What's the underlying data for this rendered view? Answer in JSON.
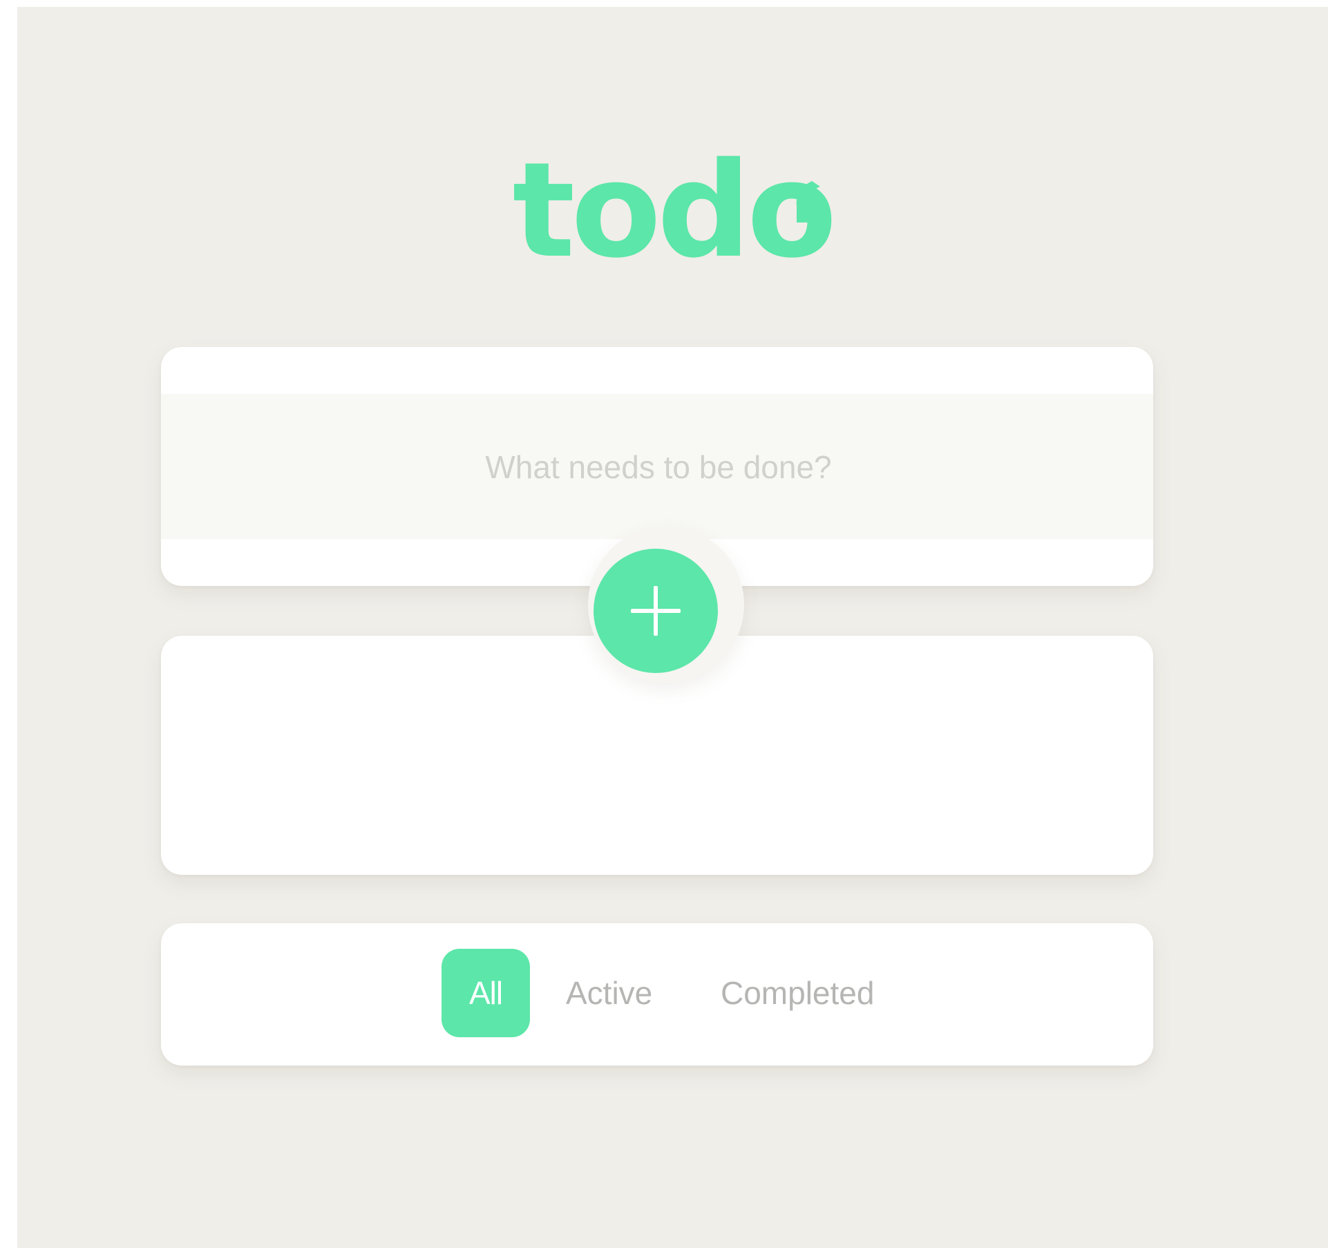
{
  "header": {
    "logo_text": "todo"
  },
  "new_todo": {
    "placeholder": "What needs to be done?",
    "value": ""
  },
  "add_button": {
    "icon": "plus-icon"
  },
  "filters": {
    "items": [
      {
        "label": "All",
        "selected": true
      },
      {
        "label": "Active",
        "selected": false
      },
      {
        "label": "Completed",
        "selected": false
      }
    ]
  },
  "colors": {
    "accent": "#5ce6a9",
    "background": "#f0eee9",
    "card": "#ffffff",
    "input_band": "#f8f8f4",
    "filter_text": "#b5b5b3",
    "placeholder": "#d0d0cc"
  }
}
